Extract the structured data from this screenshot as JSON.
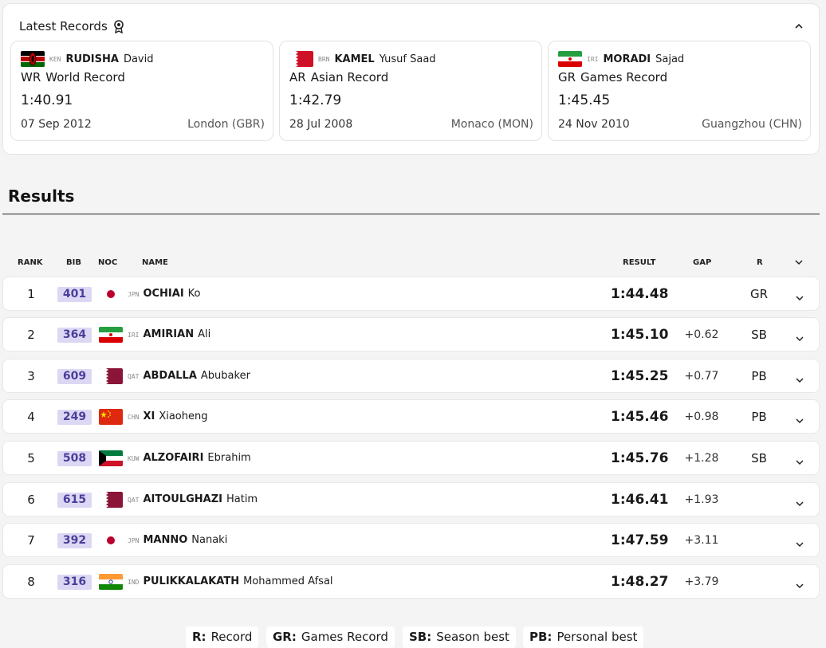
{
  "records_panel": {
    "title": "Latest Records",
    "icon": "medal-icon",
    "collapse_icon": "chevron-up-icon",
    "cards": [
      {
        "noc": "KEN",
        "surname": "RUDISHA",
        "given": "David",
        "code": "WR",
        "type": "World Record",
        "time": "1:40.91",
        "date": "07 Sep 2012",
        "place": "London (GBR)"
      },
      {
        "noc": "BRN",
        "surname": "KAMEL",
        "given": "Yusuf Saad",
        "code": "AR",
        "type": "Asian Record",
        "time": "1:42.79",
        "date": "28 Jul 2008",
        "place": "Monaco (MON)"
      },
      {
        "noc": "IRI",
        "surname": "MORADI",
        "given": "Sajad",
        "code": "GR",
        "type": "Games Record",
        "time": "1:45.45",
        "date": "24 Nov 2010",
        "place": "Guangzhou (CHN)"
      }
    ]
  },
  "results": {
    "title": "Results",
    "headers": {
      "rank": "RANK",
      "bib": "BIB",
      "noc": "NOC",
      "name": "NAME",
      "result": "RESULT",
      "gap": "GAP",
      "r": "R"
    },
    "rows": [
      {
        "rank": "1",
        "bib": "401",
        "noc": "JPN",
        "surname": "OCHIAI",
        "given": "Ko",
        "result": "1:44.48",
        "gap": "",
        "r": "GR"
      },
      {
        "rank": "2",
        "bib": "364",
        "noc": "IRI",
        "surname": "AMIRIAN",
        "given": "Ali",
        "result": "1:45.10",
        "gap": "+0.62",
        "r": "SB"
      },
      {
        "rank": "3",
        "bib": "609",
        "noc": "QAT",
        "surname": "ABDALLA",
        "given": "Abubaker",
        "result": "1:45.25",
        "gap": "+0.77",
        "r": "PB"
      },
      {
        "rank": "4",
        "bib": "249",
        "noc": "CHN",
        "surname": "XI",
        "given": "Xiaoheng",
        "result": "1:45.46",
        "gap": "+0.98",
        "r": "PB"
      },
      {
        "rank": "5",
        "bib": "508",
        "noc": "KUW",
        "surname": "ALZOFAIRI",
        "given": "Ebrahim",
        "result": "1:45.76",
        "gap": "+1.28",
        "r": "SB"
      },
      {
        "rank": "6",
        "bib": "615",
        "noc": "QAT",
        "surname": "AITOULGHAZI",
        "given": "Hatim",
        "result": "1:46.41",
        "gap": "+1.93",
        "r": ""
      },
      {
        "rank": "7",
        "bib": "392",
        "noc": "JPN",
        "surname": "MANNO",
        "given": "Nanaki",
        "result": "1:47.59",
        "gap": "+3.11",
        "r": ""
      },
      {
        "rank": "8",
        "bib": "316",
        "noc": "IND",
        "surname": "PULIKKALAKATH",
        "given": "Mohammed Afsal",
        "result": "1:48.27",
        "gap": "+3.79",
        "r": ""
      }
    ]
  },
  "legend": [
    {
      "code": "R:",
      "text": "Record"
    },
    {
      "code": "GR:",
      "text": "Games Record"
    },
    {
      "code": "SB:",
      "text": "Season best"
    },
    {
      "code": "PB:",
      "text": "Personal best"
    }
  ],
  "colors": {
    "bib_bg": "#dcd8f4",
    "bib_text": "#4a3f9a",
    "page_bg": "#f4f4f4"
  }
}
